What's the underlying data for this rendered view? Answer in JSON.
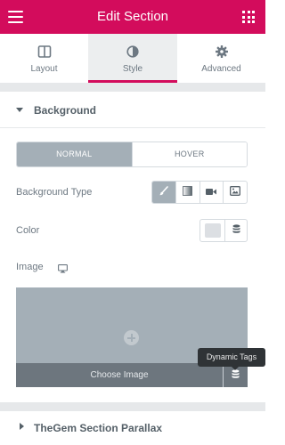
{
  "header": {
    "title": "Edit Section"
  },
  "tabs": [
    {
      "label": "Layout",
      "icon": "layout-icon"
    },
    {
      "label": "Style",
      "icon": "half-circle-icon",
      "active": true
    },
    {
      "label": "Advanced",
      "icon": "gear-icon"
    }
  ],
  "background_section": {
    "title": "Background",
    "state_toggle": {
      "normal": "NORMAL",
      "hover": "HOVER",
      "selected": "NORMAL"
    },
    "background_type": {
      "label": "Background Type",
      "options": [
        "brush-icon",
        "gradient-icon",
        "video-icon",
        "slideshow-icon"
      ],
      "selected": "brush-icon"
    },
    "color": {
      "label": "Color",
      "value": "#dcdfe3"
    },
    "image": {
      "label": "Image",
      "choose_label": "Choose Image",
      "responsive_icon": "monitor-icon"
    },
    "dynamic_tags_tooltip": "Dynamic Tags"
  },
  "parallax_section": {
    "title": "TheGem Section Parallax"
  },
  "colors": {
    "accent": "#d30c5c",
    "control": "#a4afb7",
    "text": "#6d7882"
  }
}
